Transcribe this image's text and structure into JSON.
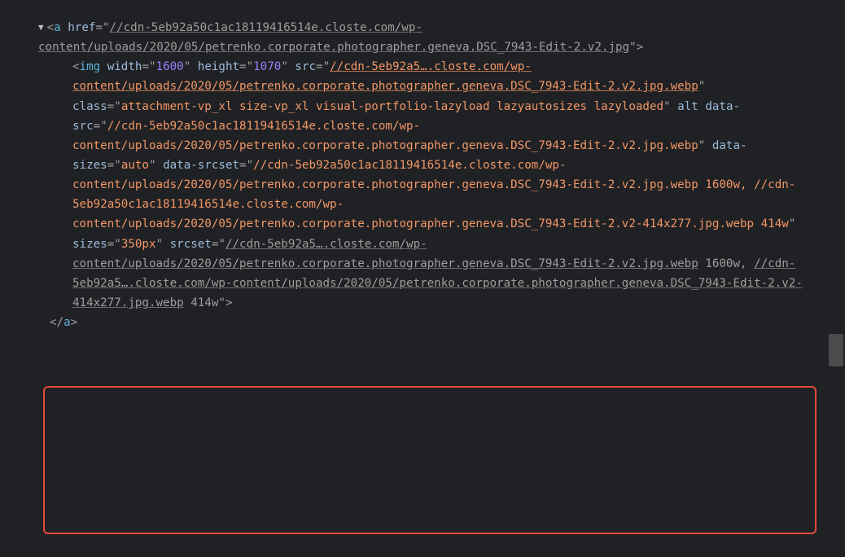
{
  "expand": "▼",
  "aOpen": {
    "lt": "<",
    "tag": "a",
    "sp1": " ",
    "hrefAttr": "href",
    "eq": "=",
    "q": "\"",
    "hrefVal": "//cdn-5eb92a50c1ac18119416514e.closte.com/wp-content/uploads/2020/05/petrenko.corporate.photographer.geneva.DSC_7943-Edit-2.v2.jpg",
    "gt": ">"
  },
  "img": {
    "lt": "<",
    "tag": "img",
    "sp": " ",
    "widthAttr": "width",
    "eq": "=",
    "q": "\"",
    "widthVal": "1600",
    "heightAttr": "height",
    "heightVal": "1070",
    "srcAttr": "src",
    "srcVal": "//cdn-5eb92a5….closte.com/wp-content/uploads/2020/05/petrenko.corporate.photographer.geneva.DSC_7943-Edit-2.v2.jpg.webp",
    "classAttr": "class",
    "classVal": "attachment-vp_xl size-vp_xl visual-portfolio-lazyload lazyautosizes lazyloaded",
    "altAttr": "alt",
    "dataSrcAttr": "data-src",
    "dataSrcVal": "//cdn-5eb92a50c1ac18119416514e.closte.com/wp-content/uploads/2020/05/petrenko.corporate.photographer.geneva.DSC_7943-Edit-2.v2.jpg.webp",
    "dataSizesAttr": "data-sizes",
    "dataSizesVal": "auto",
    "dataSrcsetAttr": "data-srcset",
    "dataSrcsetVal": "//cdn-5eb92a50c1ac18119416514e.closte.com/wp-content/uploads/2020/05/petrenko.corporate.photographer.geneva.DSC_7943-Edit-2.v2.jpg.webp 1600w, //cdn-5eb92a50c1ac18119416514e.closte.com/wp-content/uploads/2020/05/petrenko.corporate.photographer.geneva.DSC_7943-Edit-2.v2-414x277.jpg.webp 414w",
    "sizesAttr": "sizes",
    "sizesVal": "350px",
    "srcsetAttr": "srcset",
    "srcsetVal1": "//cdn-5eb92a5….closte.com/wp-content/uploads/2020/05/petrenko.corporate.photographer.geneva.DSC_7943-Edit-2.v2.jpg.webp",
    "srcsetW1": " 1600w, ",
    "srcsetVal2": "//cdn-5eb92a5….closte.com/wp-content/uploads/2020/05/petrenko.corporate.photographer.geneva.DSC_7943-Edit-2.v2-414x277.jpg.webp",
    "srcsetW2": " 414w",
    "gt": ">"
  },
  "aClose": {
    "lt": "<",
    "slash": "/",
    "tag": "a",
    "gt": ">"
  }
}
